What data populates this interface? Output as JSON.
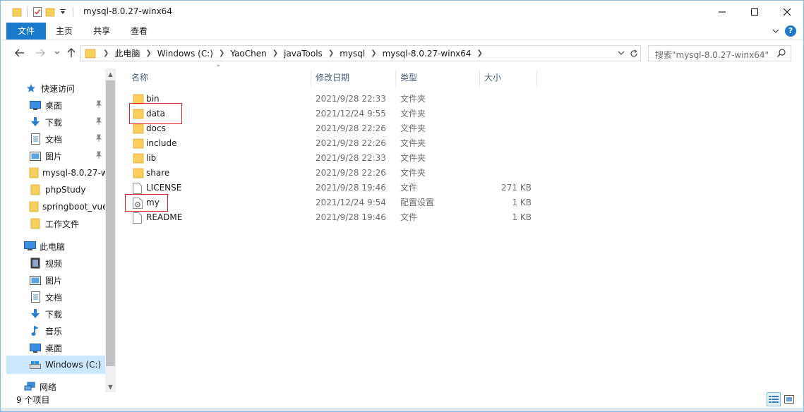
{
  "window": {
    "title": "mysql-8.0.27-winx64"
  },
  "ribbon": {
    "tabs": [
      {
        "label": "文件",
        "active": true
      },
      {
        "label": "主页"
      },
      {
        "label": "共享"
      },
      {
        "label": "查看"
      }
    ],
    "help": "?"
  },
  "address": {
    "breadcrumbs": [
      "此电脑",
      "Windows (C:)",
      "YaoChen",
      "javaTools",
      "mysql",
      "mysql-8.0.27-winx64"
    ]
  },
  "search": {
    "placeholder": "搜索\"mysql-8.0.27-winx64\""
  },
  "sidebar": {
    "items": [
      {
        "label": "快速访问",
        "icon": "star-icon",
        "pinned": false
      },
      {
        "label": "桌面",
        "icon": "desktop-icon",
        "pinned": true
      },
      {
        "label": "下载",
        "icon": "download-icon",
        "pinned": true
      },
      {
        "label": "文档",
        "icon": "document-icon",
        "pinned": true
      },
      {
        "label": "图片",
        "icon": "pictures-icon",
        "pinned": true
      },
      {
        "label": "mysql-8.0.27-w",
        "icon": "folder-icon",
        "pinned": false
      },
      {
        "label": "phpStudy",
        "icon": "folder-icon",
        "pinned": false
      },
      {
        "label": "springboot_vue",
        "icon": "folder-icon",
        "pinned": false
      },
      {
        "label": "工作文件",
        "icon": "folder-icon",
        "pinned": false
      },
      {
        "label": "此电脑",
        "icon": "computer-icon",
        "pinned": false
      },
      {
        "label": "视频",
        "icon": "video-icon",
        "pinned": false
      },
      {
        "label": "图片",
        "icon": "pictures-icon",
        "pinned": false
      },
      {
        "label": "文档",
        "icon": "document-icon",
        "pinned": false
      },
      {
        "label": "下载",
        "icon": "download-icon",
        "pinned": false
      },
      {
        "label": "音乐",
        "icon": "music-icon",
        "pinned": false
      },
      {
        "label": "桌面",
        "icon": "desktop-icon",
        "pinned": false
      },
      {
        "label": "Windows (C:)",
        "icon": "drive-icon",
        "pinned": false,
        "selected": true
      },
      {
        "label": "网络",
        "icon": "network-icon",
        "pinned": false
      }
    ]
  },
  "columns": {
    "name": "名称",
    "date": "修改日期",
    "type": "类型",
    "size": "大小"
  },
  "files": [
    {
      "name": "bin",
      "date": "2021/9/28 22:33",
      "type": "文件夹",
      "size": "",
      "icon": "folder-icon"
    },
    {
      "name": "data",
      "date": "2021/12/24 9:55",
      "type": "文件夹",
      "size": "",
      "icon": "folder-icon"
    },
    {
      "name": "docs",
      "date": "2021/9/28 22:26",
      "type": "文件夹",
      "size": "",
      "icon": "folder-icon"
    },
    {
      "name": "include",
      "date": "2021/9/28 22:26",
      "type": "文件夹",
      "size": "",
      "icon": "folder-icon"
    },
    {
      "name": "lib",
      "date": "2021/9/28 22:33",
      "type": "文件夹",
      "size": "",
      "icon": "folder-icon"
    },
    {
      "name": "share",
      "date": "2021/9/28 22:26",
      "type": "文件夹",
      "size": "",
      "icon": "folder-icon"
    },
    {
      "name": "LICENSE",
      "date": "2021/9/28 19:46",
      "type": "文件",
      "size": "271 KB",
      "icon": "file-icon"
    },
    {
      "name": "my",
      "date": "2021/12/24 9:54",
      "type": "配置设置",
      "size": "1 KB",
      "icon": "config-file-icon"
    },
    {
      "name": "README",
      "date": "2021/9/28 19:46",
      "type": "文件",
      "size": "1 KB",
      "icon": "file-icon"
    }
  ],
  "status": {
    "item_count": "9 个项目"
  },
  "colors": {
    "accent": "#1979ca",
    "folder": "#f7cf5b",
    "highlight_box": "#e02020",
    "selected_bg": "#cce8ff"
  }
}
